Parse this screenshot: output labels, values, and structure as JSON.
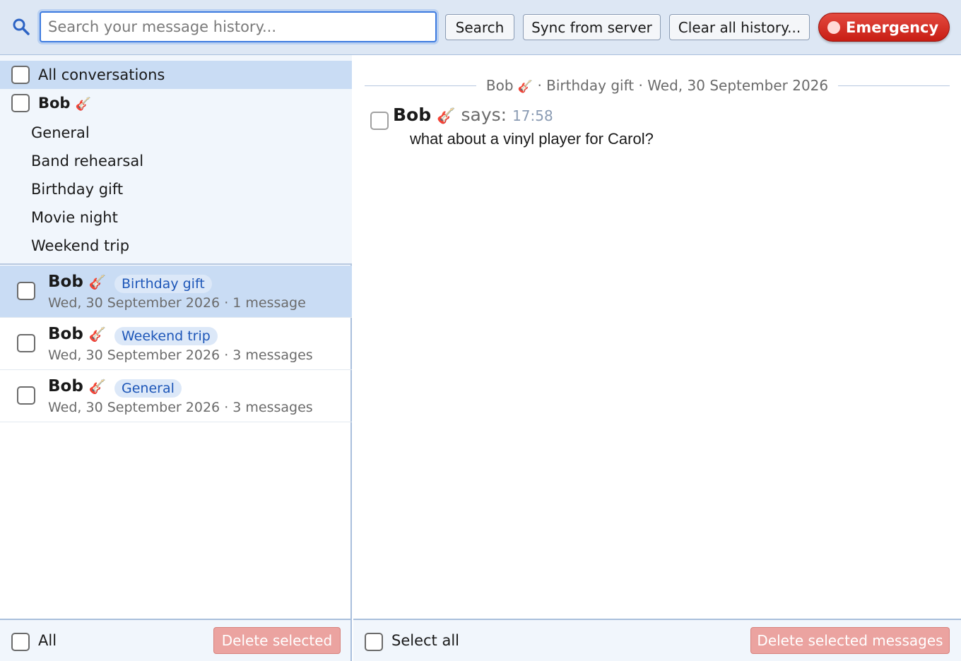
{
  "toolbar": {
    "search_placeholder": "Search your message history...",
    "search_value": "",
    "search_button": "Search",
    "sync_button": "Sync from server",
    "clear_button": "Clear all history...",
    "emergency_button": "Emergency"
  },
  "tree": {
    "all_label": "All conversations",
    "contact_name": "Bob",
    "contact_emoji": "🎸",
    "topics": [
      "General",
      "Band rehearsal",
      "Birthday gift",
      "Movie night",
      "Weekend trip"
    ]
  },
  "conversations": [
    {
      "name": "Bob",
      "emoji": "🎸",
      "tag": "Birthday gift",
      "date": "Wed, 30 September 2026",
      "count": "1 message",
      "selected": true
    },
    {
      "name": "Bob",
      "emoji": "🎸",
      "tag": "Weekend trip",
      "date": "Wed, 30 September 2026",
      "count": "3 messages",
      "selected": false
    },
    {
      "name": "Bob",
      "emoji": "🎸",
      "tag": "General",
      "date": "Wed, 30 September 2026",
      "count": "3 messages",
      "selected": false
    }
  ],
  "left_footer": {
    "all_label": "All",
    "delete_button": "Delete selected"
  },
  "thread": {
    "header_contact": "Bob",
    "header_emoji": "🎸",
    "header_topic": "Birthday gift",
    "header_date": "Wed, 30 September 2026",
    "messages": [
      {
        "sender": "Bob",
        "emoji": "🎸",
        "says": "says:",
        "time": "17:58",
        "text": "what about a vinyl player for Carol?"
      }
    ]
  },
  "right_footer": {
    "select_all_label": "Select all",
    "delete_button": "Delete selected messages"
  },
  "colors": {
    "accent": "#3d7be0",
    "selection": "#c9dcf4",
    "tag_text": "#1d56b8",
    "emergency": "#c81d14"
  }
}
